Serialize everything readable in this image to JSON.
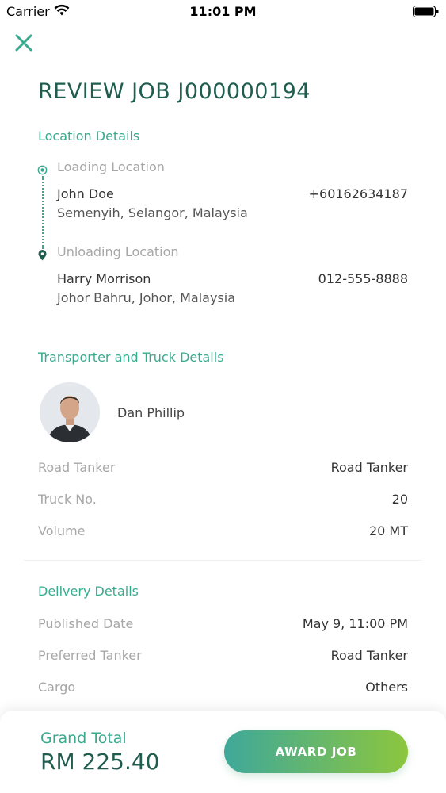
{
  "status_bar": {
    "carrier": "Carrier",
    "time": "11:01 PM"
  },
  "page": {
    "title": "REVIEW JOB J000000194"
  },
  "location": {
    "section_title": "Location Details",
    "loading": {
      "label": "Loading Location",
      "name": "John Doe",
      "phone": "+60162634187",
      "address": "Semenyih, Selangor, Malaysia"
    },
    "unloading": {
      "label": "Unloading Location",
      "name": "Harry Morrison",
      "phone": "012-555-8888",
      "address": "Johor Bahru, Johor, Malaysia"
    }
  },
  "transporter": {
    "section_title": "Transporter and Truck Details",
    "driver_name": "Dan Phillip",
    "rows": [
      {
        "label": "Road Tanker",
        "value": "Road Tanker"
      },
      {
        "label": "Truck No.",
        "value": "20"
      },
      {
        "label": "Volume",
        "value": "20 MT"
      }
    ]
  },
  "delivery": {
    "section_title": "Delivery Details",
    "rows": [
      {
        "label": "Published Date",
        "value": "May 9, 11:00 PM"
      },
      {
        "label": "Preferred Tanker",
        "value": "Road Tanker"
      },
      {
        "label": "Cargo",
        "value": "Others"
      }
    ]
  },
  "footer": {
    "grand_total_label": "Grand Total",
    "grand_total_value": "RM 225.40",
    "award_button_label": "AWARD JOB"
  },
  "colors": {
    "accent": "#3aaa8e",
    "title": "#1f5d4f",
    "button_gradient_start": "#3fa89a",
    "button_gradient_end": "#8cc63e"
  },
  "icons": [
    "wifi-icon",
    "battery-icon",
    "close-icon",
    "loading-location-icon",
    "unloading-location-pin-icon",
    "driver-avatar"
  ]
}
